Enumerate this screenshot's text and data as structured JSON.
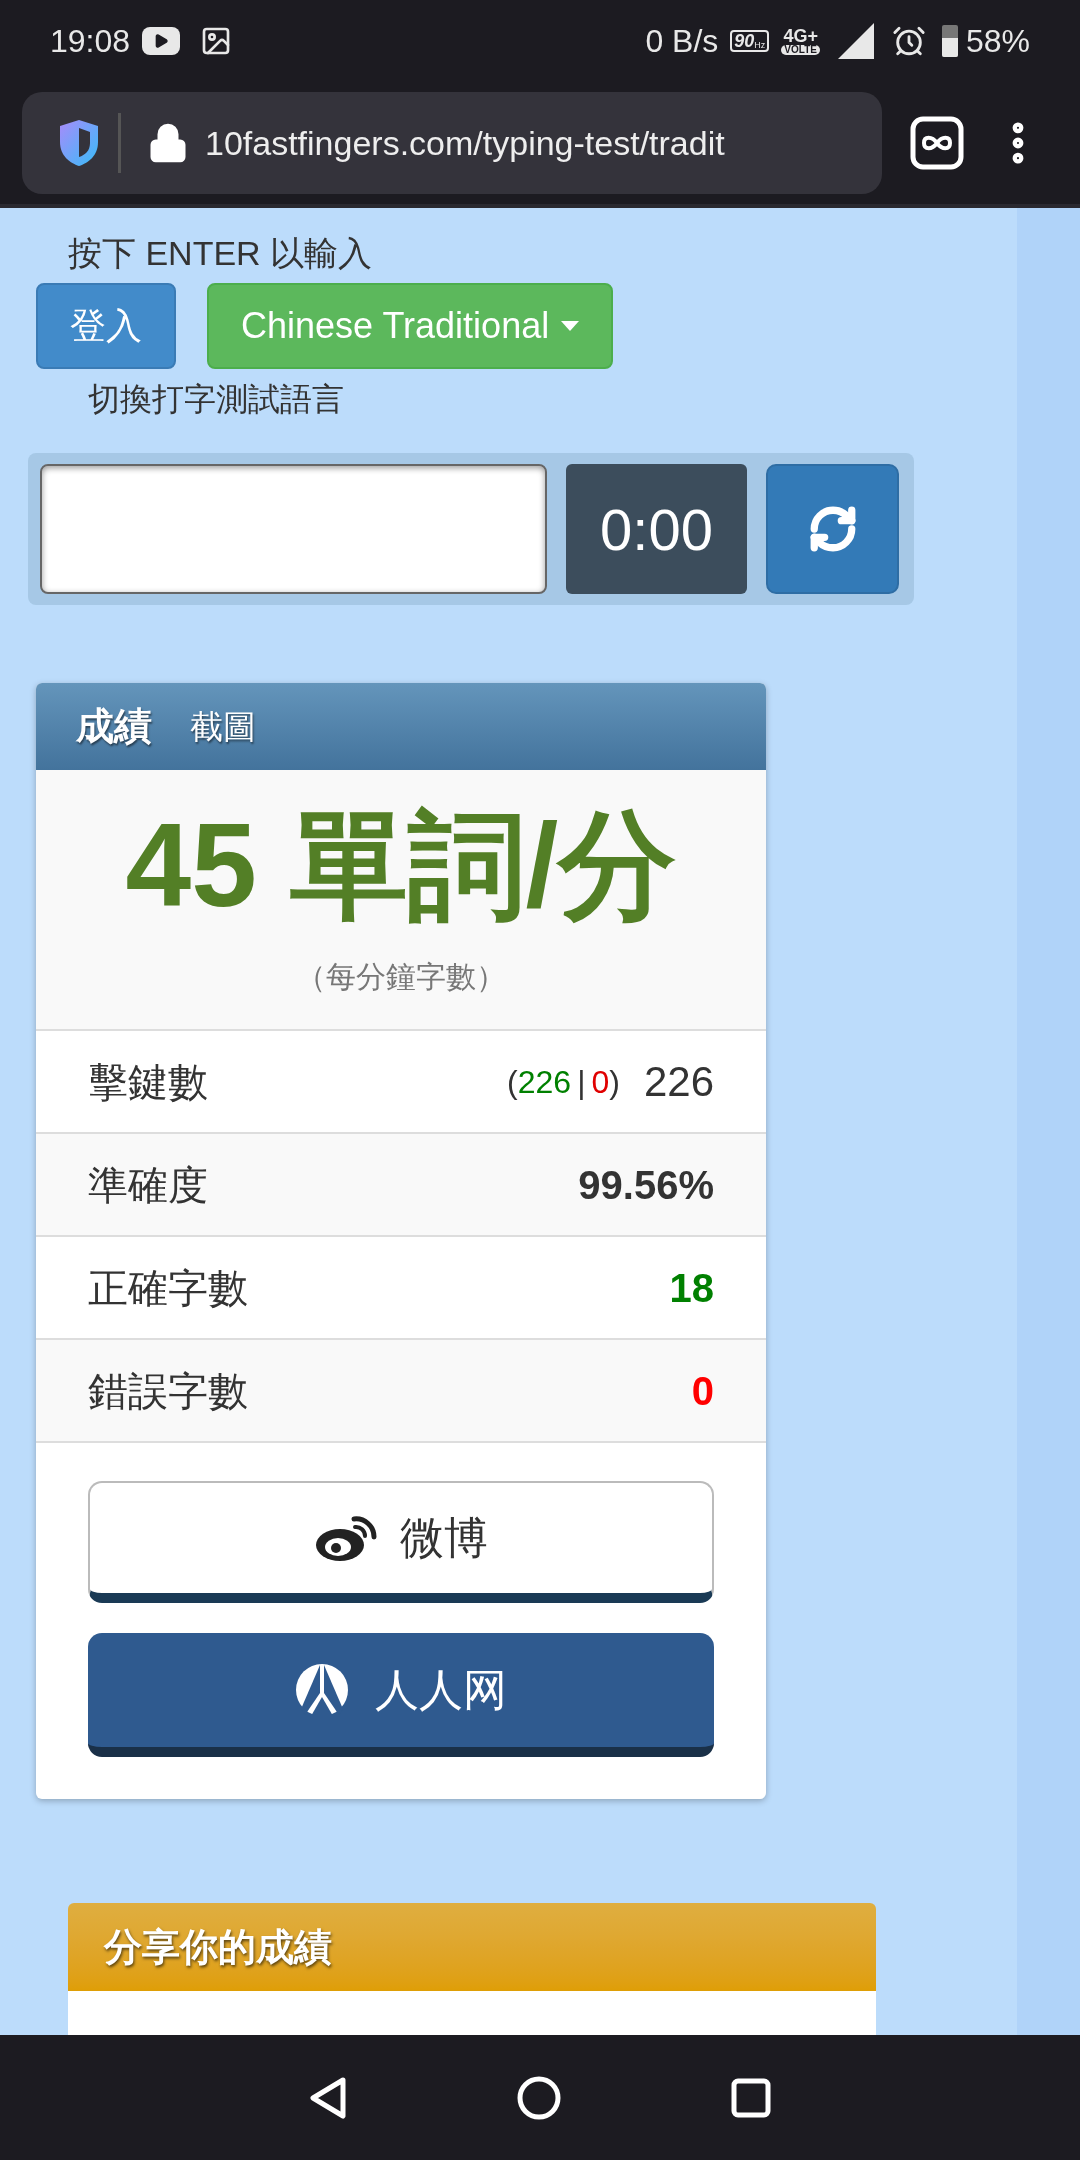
{
  "status_bar": {
    "time": "19:08",
    "speed": "0 B/s",
    "refresh_rate": "90",
    "refresh_unit": "Hz",
    "network": "4G+",
    "volte": "VOLTE",
    "battery": "58%"
  },
  "browser": {
    "url": "10fastfingers.com/typing-test/tradit"
  },
  "page": {
    "hint": "按下 ENTER 以輸入",
    "login_button": "登入",
    "language_button": "Chinese Traditional",
    "language_caption": "切換打字測試語言",
    "timer": "0:00"
  },
  "results": {
    "tabs": [
      {
        "label": "成績",
        "selected": true
      },
      {
        "label": "截圖",
        "selected": false
      }
    ],
    "speed": "45 單詞/分",
    "speed_caption": "（每分鐘字數）",
    "rows": [
      {
        "kind": "keystrokes",
        "label": "擊鍵數",
        "open": "(",
        "correct": "226",
        "separator": "|",
        "wrong": "0",
        "close": ")",
        "value": "226"
      },
      {
        "kind": "plain",
        "label": "準確度",
        "value": "99.56%",
        "color": "#333333"
      },
      {
        "kind": "plain",
        "label": "正確字數",
        "value": "18",
        "color": "#008000"
      },
      {
        "kind": "plain",
        "label": "錯誤字數",
        "value": "0",
        "color": "#ff0000"
      }
    ],
    "share_buttons": [
      {
        "kind": "weibo",
        "label": "微博"
      },
      {
        "kind": "renren",
        "label": "人人网"
      }
    ]
  },
  "share_panel": {
    "title": "分享你的成績"
  }
}
